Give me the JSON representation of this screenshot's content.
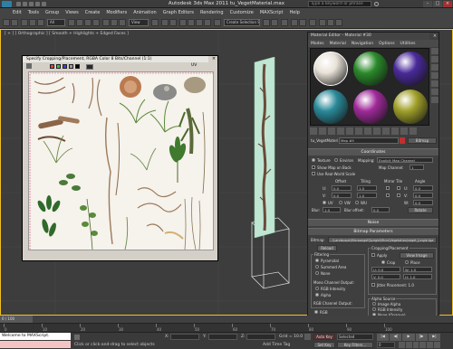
{
  "app": {
    "title": "Autodesk 3ds Max 2011    tu_VegetMaterial.max",
    "search_placeholder": "Type a keyword or phrase"
  },
  "menu": [
    "Edit",
    "Tools",
    "Group",
    "Views",
    "Create",
    "Modifiers",
    "Animation",
    "Graph Editors",
    "Rendering",
    "Customize",
    "MAXScript",
    "Help"
  ],
  "toolbar": {
    "selection_filter": "All",
    "reference_coord": "View",
    "named_selection": "Create Selection Se"
  },
  "viewport": {
    "label": "[ + ] [ Orthographic ] [ Smooth + Highlights + Edged Faces ]"
  },
  "crop_window": {
    "title": "Specify Cropping/Placement, RGBA Color 8 Bits/Channel (1:1)",
    "uv_label": "UV",
    "color_channels": [
      "#e04040",
      "#40c040",
      "#4040e0",
      "#a0a0a0",
      "#000000"
    ]
  },
  "material_editor": {
    "title": "Material Editor - Material #30",
    "menu": [
      "Modes",
      "Material",
      "Navigation",
      "Options",
      "Utilities"
    ],
    "slots": [
      {
        "color": "#e8e2d8",
        "selected": true
      },
      {
        "color": "#2a8a2a"
      },
      {
        "color": "#4a2a9a"
      },
      {
        "color": "#2a8a9a"
      },
      {
        "color": "#a02a9a"
      },
      {
        "color": "#a0a02a"
      }
    ],
    "map_name": "Map #5",
    "map_type": "Bitmap",
    "material_name": "tu_VegetMaterial",
    "coordinates": {
      "header": "Coordinates",
      "texture_label": "Texture",
      "environ_label": "Environ",
      "mapping_label": "Mapping:",
      "mapping_value": "Explicit Map Channel",
      "show_map_back": "Show Map on Back",
      "map_channel_label": "Map Channel:",
      "map_channel_value": "1",
      "real_world": "Use Real-World Scale",
      "col_offset": "Offset",
      "col_tiling": "Tiling",
      "col_mirror": "Mirror Tile",
      "col_angle": "Angle",
      "u_label": "U:",
      "v_label": "V:",
      "w_label": "W:",
      "u_offset": "0.0",
      "v_offset": "0.0",
      "u_tiling": "1.0",
      "v_tiling": "1.0",
      "u_angle": "0.0",
      "v_angle": "0.0",
      "w_angle": "0.0",
      "uv": "UV",
      "vw": "VW",
      "wu": "WU",
      "blur_label": "Blur:",
      "blur_value": "1.0",
      "blur_offset_label": "Blur offset:",
      "blur_offset_value": "0.0",
      "rotate": "Rotate"
    },
    "noise_header": "Noise",
    "bitmap_params": {
      "header": "Bitmap Parameters",
      "bitmap_label": "Bitmap:",
      "bitmap_path": "...\\Landscape\\Microangel\\Sprigle\\Micro\\Vegetation\\veget_jungle.tga",
      "reload": "Reload",
      "cropping_header": "Cropping/Placement",
      "apply": "Apply",
      "view_image": "View Image",
      "crop": "Crop",
      "place": "Place",
      "u": "U: 0.0",
      "w": "W: 1.0",
      "v": "V: 0.0",
      "h": "H: 1.0",
      "jitter": "Jitter Placement: 1.0",
      "filtering_header": "Filtering",
      "pyramidal": "Pyramidal",
      "summed_area": "Summed Area",
      "none": "None",
      "mono_header": "Mono Channel Output:",
      "rgb_intensity": "RGB Intensity",
      "alpha": "Alpha",
      "rgb_header": "RGB Channel Output:",
      "rgb": "RGB",
      "alpha_source_header": "Alpha Source",
      "image_alpha": "Image Alpha",
      "rgb_intensity2": "RGB Intensity",
      "none_opaque": "None (Opaque)"
    }
  },
  "timeline": {
    "frame": "0 / 100",
    "ticks": [
      "0",
      "10",
      "20",
      "30",
      "40",
      "50",
      "60",
      "70",
      "80",
      "90",
      "100"
    ]
  },
  "status": {
    "maxscript": "Welcome to MAXScript.",
    "prompt": "Click or click-and-drag to select objects",
    "grid": "Grid = 10.0",
    "add_time_tag": "Add Time Tag",
    "auto_key": "Auto Key",
    "selected": "Selected",
    "set_key": "Set Key",
    "key_filters": "Key Filters...",
    "x": "X:",
    "y": "Y:",
    "z": "Z:",
    "frame_field": "0",
    "accent": "#c01010"
  }
}
